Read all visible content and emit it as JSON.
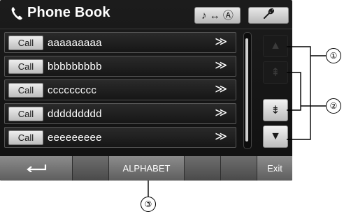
{
  "header": {
    "title": "Phone Book",
    "title_icon": "phone-handset-icon",
    "mode_button_icon": "note-swap-source-icon",
    "mode_button_text": "♪ ↔ Ⓐ",
    "setup_button_icon": "wrench-icon"
  },
  "entries": [
    {
      "call_label": "Call",
      "name": "aaaaaaaaa",
      "detail_glyph": "≫"
    },
    {
      "call_label": "Call",
      "name": "bbbbbbbbb",
      "detail_glyph": "≫"
    },
    {
      "call_label": "Call",
      "name": "ccccccccc",
      "detail_glyph": "≫"
    },
    {
      "call_label": "Call",
      "name": "ddddddddd",
      "detail_glyph": "≫"
    },
    {
      "call_label": "Call",
      "name": "eeeeeeeee",
      "detail_glyph": "≫"
    }
  ],
  "navigation": {
    "page_up_glyph": "▲",
    "fast_up_glyph": "⇞",
    "fast_down_glyph": "⇟",
    "page_down_glyph": "▼",
    "page_up_enabled": false,
    "fast_up_enabled": false,
    "fast_down_enabled": true,
    "page_down_enabled": true
  },
  "footer": {
    "back_icon": "back-arrow-icon",
    "alphabet_label": "ALPHABET",
    "exit_label": "Exit"
  },
  "callouts": {
    "one": "①",
    "two": "②",
    "three": "③"
  }
}
